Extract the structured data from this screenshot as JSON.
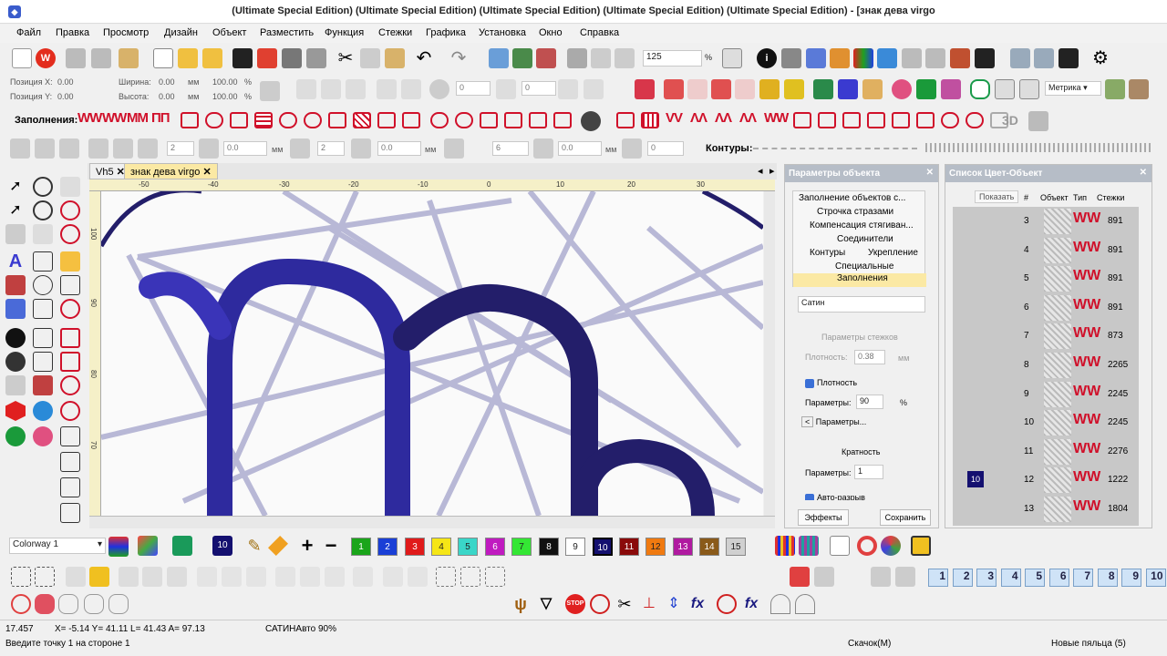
{
  "window": {
    "title": "(Ultimate Special Edition) (Ultimate Special Edition) (Ultimate Special Edition) (Ultimate Special Edition) (Ultimate Special Edition) - [знак дева virgo"
  },
  "menu": [
    "Файл",
    "Правка",
    "Просмотр",
    "Дизайн",
    "Объект",
    "Разместить",
    "Функция",
    "Стежки",
    "Графика",
    "Установка",
    "Окно",
    "Справка"
  ],
  "toolbar": {
    "zoom_value": "125",
    "zoom_unit": "%",
    "metric_select": "Метрика"
  },
  "position": {
    "pos_x_label": "Позиция X:",
    "pos_x_value": "0.00",
    "pos_y_label": "Позиция Y:",
    "pos_y_value": "0.00",
    "width_label": "Ширина:",
    "width_value": "0.00",
    "height_label": "Высота:",
    "height_value": "0.00",
    "scale_x": "100.00",
    "scale_y": "100.00",
    "unit_mm": "мм",
    "unit_pct": "%",
    "rot_value": "0"
  },
  "fills_toolbar": {
    "label": "Заполнения:",
    "threeD": "3D"
  },
  "row4": {
    "field1": "2",
    "field2": "0.0",
    "field3": "2",
    "field4": "0.0",
    "field5": "6",
    "field6": "0.0",
    "field7": "0",
    "unit": "мм",
    "contours_label": "Контуры:"
  },
  "doc_tabs": [
    {
      "label": "Vh5"
    },
    {
      "label": "знак дева virgo"
    }
  ],
  "ruler_top": [
    "-50",
    "-40",
    "-30",
    "-20",
    "-10",
    "0",
    "10",
    "20",
    "30"
  ],
  "ruler_left": [
    "100",
    "90",
    "80",
    "70"
  ],
  "params_panel": {
    "title": "Параметры объекта",
    "tree": [
      "Заполнение объектов с...",
      "Строчка стразами",
      "Компенсация стягиван...",
      "Соединители",
      "Контуры",
      "Укрепление",
      "Специальные",
      "Заполнения"
    ],
    "fill_type": "Сатин",
    "stitch_params_label": "Параметры стежков",
    "density_label": "Плотность:",
    "density_value": "0.38",
    "density_unit": "мм",
    "density_check": "Плотность",
    "params_label": "Параметры:",
    "params_value": "90",
    "params_unit": "%",
    "params_more": "Параметры...",
    "multiplicity_label": "Кратность",
    "params2_label": "Параметры:",
    "params2_value": "1",
    "auto_label": "Авто-разрыв",
    "effects_button": "Эффекты",
    "save_button": "Сохранить"
  },
  "color_list": {
    "title": "Список Цвет-Объект",
    "show_button": "Показать",
    "headers": [
      "#",
      "Объект",
      "Тип",
      "Стежки"
    ],
    "rows": [
      {
        "num": "3",
        "stitches": "891"
      },
      {
        "num": "4",
        "stitches": "891"
      },
      {
        "num": "5",
        "stitches": "891"
      },
      {
        "num": "6",
        "stitches": "891"
      },
      {
        "num": "7",
        "stitches": "873"
      },
      {
        "num": "8",
        "stitches": "2265"
      },
      {
        "num": "9",
        "stitches": "2245"
      },
      {
        "num": "10",
        "stitches": "2245"
      },
      {
        "num": "11",
        "stitches": "2276"
      },
      {
        "num": "12",
        "stitches": "1222",
        "color_badge": "10"
      },
      {
        "num": "13",
        "stitches": "1804"
      }
    ]
  },
  "colorway": {
    "select": "Colorway 1",
    "current_color": "10"
  },
  "palette": [
    {
      "label": "1",
      "color": "#1aa51a"
    },
    {
      "label": "2",
      "color": "#1a3fd6"
    },
    {
      "label": "3",
      "color": "#e01a1a"
    },
    {
      "label": "4",
      "color": "#f5e616"
    },
    {
      "label": "5",
      "color": "#3ad6c8"
    },
    {
      "label": "6",
      "color": "#c01ac0"
    },
    {
      "label": "7",
      "color": "#34e634"
    },
    {
      "label": "8",
      "color": "#111111"
    },
    {
      "label": "9",
      "color": "#ffffff"
    },
    {
      "label": "10",
      "color": "#141070"
    },
    {
      "label": "11",
      "color": "#8a0a0a"
    },
    {
      "label": "12",
      "color": "#f07a10"
    },
    {
      "label": "13",
      "color": "#b01aa0"
    },
    {
      "label": "14",
      "color": "#8a5a1a"
    },
    {
      "label": "15",
      "color": "#d0d0d0"
    }
  ],
  "hoop_buttons": [
    "1",
    "2",
    "3",
    "4",
    "5",
    "6",
    "7",
    "8",
    "9",
    "10"
  ],
  "status": {
    "coord_left": "17.457",
    "coords": "X= -5.14 Y= 41.11 L= 41.43 A= 97.13",
    "mode": "САТИНАвто 90%",
    "prompt": "Введите точку 1 на стороне 1",
    "jump": "Скачок(M)",
    "hoop": "Новые пяльца (5)"
  }
}
